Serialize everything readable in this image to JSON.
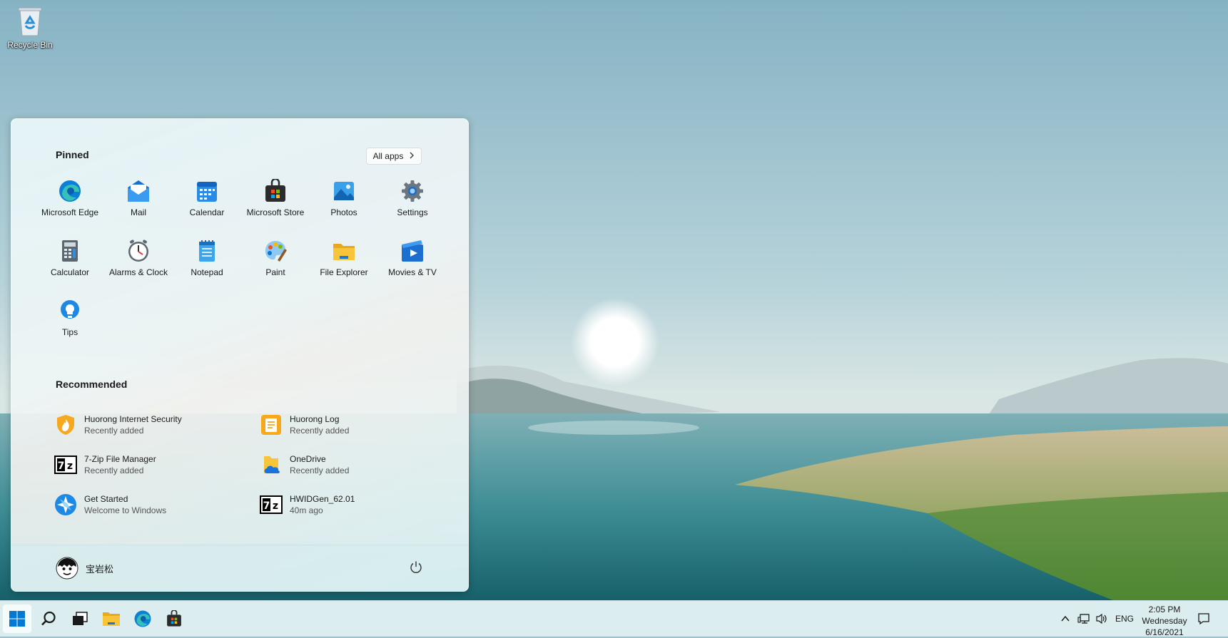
{
  "desktop": {
    "recycle_bin_label": "Recycle Bin"
  },
  "start_menu": {
    "pinned_title": "Pinned",
    "all_apps_label": "All apps",
    "pinned": [
      {
        "label": "Microsoft Edge",
        "icon": "edge-icon"
      },
      {
        "label": "Mail",
        "icon": "mail-icon"
      },
      {
        "label": "Calendar",
        "icon": "calendar-icon"
      },
      {
        "label": "Microsoft Store",
        "icon": "store-icon"
      },
      {
        "label": "Photos",
        "icon": "photos-icon"
      },
      {
        "label": "Settings",
        "icon": "settings-icon"
      },
      {
        "label": "Calculator",
        "icon": "calculator-icon"
      },
      {
        "label": "Alarms & Clock",
        "icon": "alarm-clock-icon"
      },
      {
        "label": "Notepad",
        "icon": "notepad-icon"
      },
      {
        "label": "Paint",
        "icon": "paint-icon"
      },
      {
        "label": "File Explorer",
        "icon": "folder-icon"
      },
      {
        "label": "Movies & TV",
        "icon": "movies-icon"
      },
      {
        "label": "Tips",
        "icon": "tips-icon"
      }
    ],
    "recommended_title": "Recommended",
    "recommended": [
      {
        "title": "Huorong Internet Security",
        "subtitle": "Recently added",
        "icon": "shield-flame-icon"
      },
      {
        "title": "Huorong Log",
        "subtitle": "Recently added",
        "icon": "log-icon"
      },
      {
        "title": "7-Zip File Manager",
        "subtitle": "Recently added",
        "icon": "7zip-icon"
      },
      {
        "title": "OneDrive",
        "subtitle": "Recently added",
        "icon": "onedrive-icon"
      },
      {
        "title": "Get Started",
        "subtitle": "Welcome to Windows",
        "icon": "get-started-icon"
      },
      {
        "title": "HWIDGen_62.01",
        "subtitle": "40m ago",
        "icon": "7zip-icon"
      }
    ],
    "user_name": "宝岩松"
  },
  "taskbar": {
    "language": "ENG",
    "time": "2:05 PM",
    "day": "Wednesday",
    "date": "6/16/2021"
  },
  "colors": {
    "accent": "#0078d4",
    "folder": "#f8c43a"
  }
}
